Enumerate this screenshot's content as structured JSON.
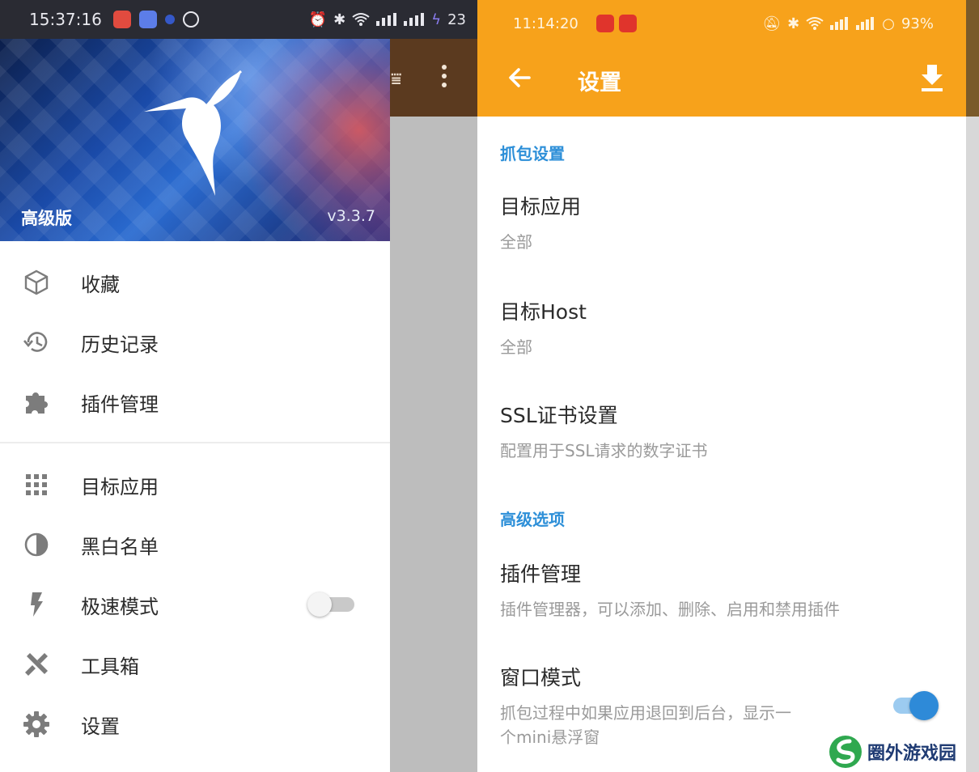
{
  "left_screen": {
    "status_bar": {
      "time": "15:37:16",
      "battery": "23"
    },
    "drawer_header": {
      "title": "高级版",
      "version": "v3.3.7"
    },
    "menu": {
      "favorites": "收藏",
      "history": "历史记录",
      "plugins": "插件管理",
      "target_apps": "目标应用",
      "blacklist": "黑白名单",
      "speed_mode": "极速模式",
      "toolbox": "工具箱",
      "settings": "设置"
    },
    "speed_mode_enabled": false
  },
  "right_screen": {
    "status_bar": {
      "time": "11:14:20",
      "battery": "93%"
    },
    "appbar": {
      "title": "设置"
    },
    "sections": {
      "capture": {
        "title": "抓包设置",
        "target_app": {
          "title": "目标应用",
          "summary": "全部"
        },
        "target_host": {
          "title": "目标Host",
          "summary": "全部"
        },
        "ssl": {
          "title": "SSL证书设置",
          "summary": "配置用于SSL请求的数字证书"
        }
      },
      "advanced": {
        "title": "高级选项",
        "plugins": {
          "title": "插件管理",
          "summary": "插件管理器，可以添加、删除、启用和禁用插件"
        },
        "window_mode": {
          "title": "窗口模式",
          "summary_line1": "抓包过程中如果应用退回到后台，显示一",
          "summary_line2": "个mini悬浮窗"
        }
      }
    },
    "window_mode_enabled": true
  },
  "watermark": {
    "text": "圈外游戏园"
  },
  "colors": {
    "appbar": "#f7a21b",
    "accent": "#2d8fd8",
    "switch_on": "#2e8ad8"
  }
}
